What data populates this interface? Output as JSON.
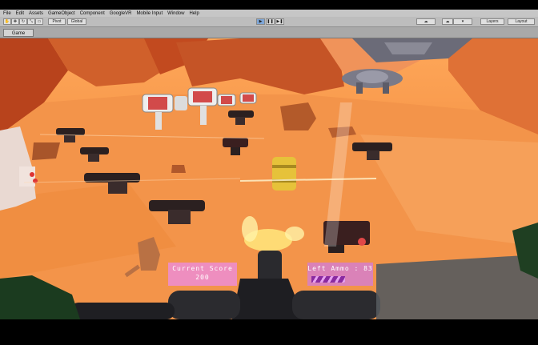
{
  "menu": [
    "File",
    "Edit",
    "Assets",
    "GameObject",
    "Component",
    "GoogleVR",
    "Mobile Input",
    "Window",
    "Help"
  ],
  "toolbar": {
    "pivot_label": "Pivot",
    "global_label": "Global",
    "layers_label": "Layers",
    "layout_label": "Layout"
  },
  "tab": {
    "label": "Game"
  },
  "hud": {
    "score_label": "Current Score",
    "score_value": "200",
    "ammo_label": "Left Ammo : 83",
    "ammo_fill": 0.6
  }
}
